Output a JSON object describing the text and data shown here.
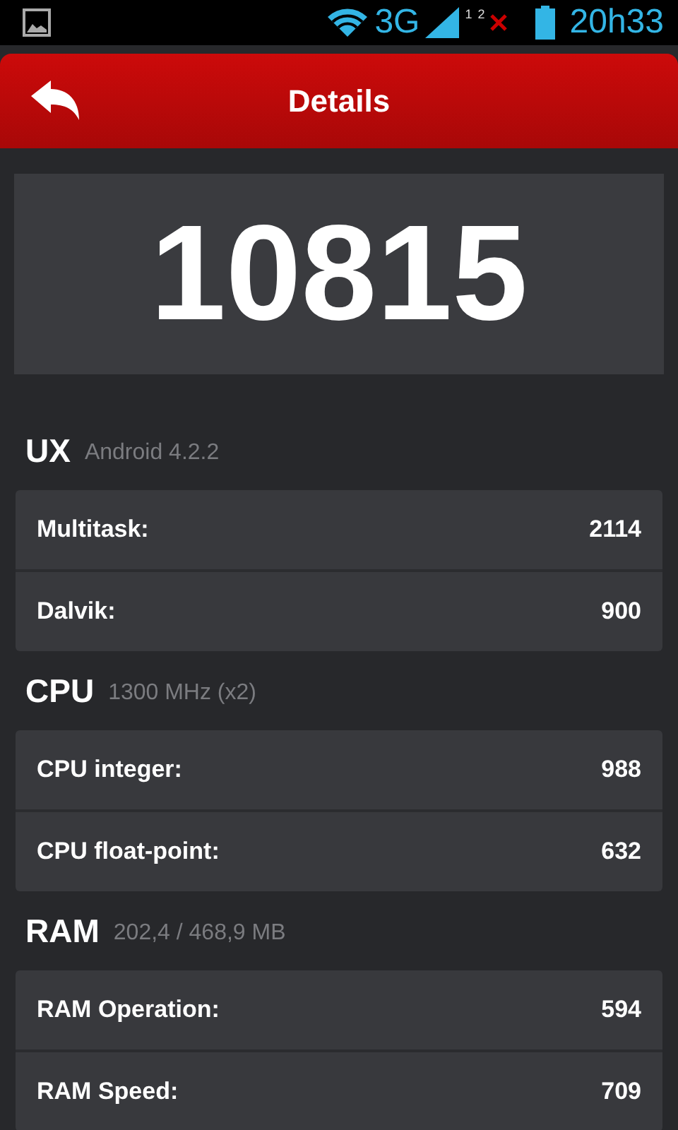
{
  "status_bar": {
    "network": "3G",
    "sim_1": "1",
    "sim_2": "2",
    "time": "20h33"
  },
  "header": {
    "title": "Details"
  },
  "score": "10815",
  "sections": [
    {
      "title": "UX",
      "subtitle": "Android 4.2.2",
      "rows": [
        {
          "label": "Multitask:",
          "value": "2114"
        },
        {
          "label": "Dalvik:",
          "value": "900"
        }
      ]
    },
    {
      "title": "CPU",
      "subtitle": "1300 MHz (x2)",
      "rows": [
        {
          "label": "CPU integer:",
          "value": "988"
        },
        {
          "label": "CPU float-point:",
          "value": "632"
        }
      ]
    },
    {
      "title": "RAM",
      "subtitle": "202,4 / 468,9 MB",
      "rows": [
        {
          "label": "RAM Operation:",
          "value": "594"
        },
        {
          "label": "RAM Speed:",
          "value": "709"
        }
      ]
    }
  ]
}
